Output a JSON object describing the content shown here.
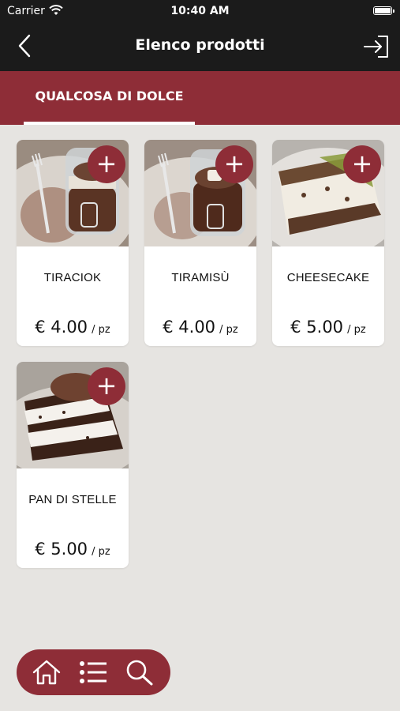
{
  "status_bar": {
    "carrier": "Carrier",
    "time": "10:40 AM"
  },
  "header": {
    "title": "Elenco prodotti"
  },
  "tabs": [
    {
      "label": "QUALCOSA DI DOLCE",
      "active": true
    }
  ],
  "products": [
    {
      "name": "TIRACIOK",
      "price": "€ 4.00",
      "unit": "/ pz",
      "add_label": "+"
    },
    {
      "name": "TIRAMISÙ",
      "price": "€ 4.00",
      "unit": "/ pz",
      "add_label": "+"
    },
    {
      "name": "CHEESECAKE",
      "price": "€ 5.00",
      "unit": "/ pz",
      "add_label": "+"
    },
    {
      "name": "PAN DI STELLE",
      "price": "€ 5.00",
      "unit": "/ pz",
      "add_label": "+"
    }
  ],
  "bottom_nav": {
    "icons": [
      "home-icon",
      "list-icon",
      "search-icon"
    ]
  },
  "colors": {
    "brand": "#8e2d37",
    "header": "#1b1b1b",
    "background": "#e6e4e1"
  }
}
